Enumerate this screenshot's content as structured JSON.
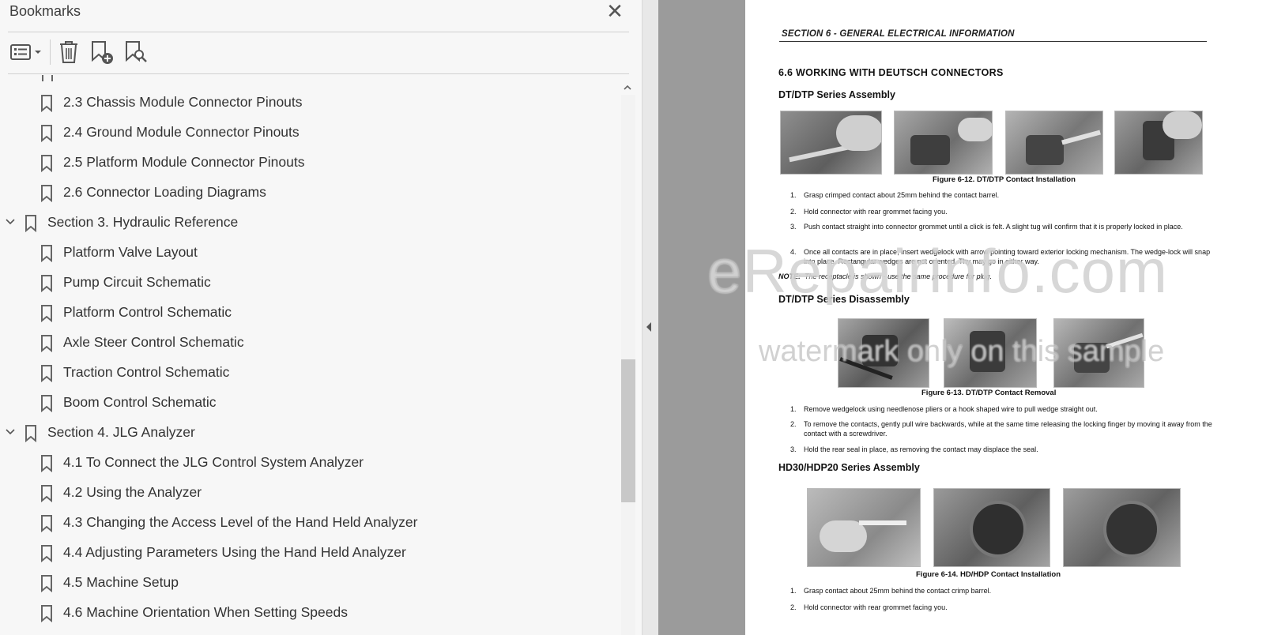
{
  "panel": {
    "title": "Bookmarks",
    "toolbar": {
      "options_icon": "list-options-icon",
      "delete_icon": "trash-icon",
      "new_bookmark_icon": "bookmark-add-icon",
      "find_bookmark_icon": "bookmark-search-icon"
    },
    "items": [
      {
        "level": 2,
        "label": "2.3 Chassis Module Connector Pinouts"
      },
      {
        "level": 2,
        "label": "2.4 Ground Module Connector Pinouts"
      },
      {
        "level": 2,
        "label": "2.5 Platform Module Connector Pinouts"
      },
      {
        "level": 2,
        "label": "2.6 Connector Loading Diagrams"
      },
      {
        "level": 1,
        "label": "Section 3. Hydraulic Reference",
        "expanded": true
      },
      {
        "level": 2,
        "label": "Platform Valve Layout"
      },
      {
        "level": 2,
        "label": "Pump Circuit Schematic"
      },
      {
        "level": 2,
        "label": "Platform Control Schematic"
      },
      {
        "level": 2,
        "label": "Axle Steer Control Schematic"
      },
      {
        "level": 2,
        "label": "Traction Control Schematic"
      },
      {
        "level": 2,
        "label": "Boom Control Schematic"
      },
      {
        "level": 1,
        "label": "Section 4. JLG Analyzer",
        "expanded": true
      },
      {
        "level": 2,
        "label": "4.1 To Connect the JLG Control System Analyzer"
      },
      {
        "level": 2,
        "label": "4.2 Using the Analyzer"
      },
      {
        "level": 2,
        "label": "4.3 Changing the Access Level of the Hand Held Analyzer"
      },
      {
        "level": 2,
        "label": "4.4 Adjusting Parameters Using the Hand Held Analyzer"
      },
      {
        "level": 2,
        "label": "4.5 Machine Setup"
      },
      {
        "level": 2,
        "label": "4.6 Machine Orientation When Setting Speeds"
      }
    ]
  },
  "document": {
    "section_header": "SECTION 6 - GENERAL ELECTRICAL INFORMATION",
    "heading": "6.6  WORKING WITH DEUTSCH CONNECTORS",
    "sub1": "DT/DTP Series Assembly",
    "fig1_caption": "Figure 6-12.  DT/DTP Contact Installation",
    "steps1": [
      {
        "num": "1.",
        "text": "Grasp crimped contact about 25mm behind the contact barrel."
      },
      {
        "num": "2.",
        "text": "Hold connector with rear grommet facing you."
      },
      {
        "num": "3.",
        "text": "Push contact straight into connector grommet until a click is felt. A slight tug will confirm that it is properly locked in place."
      },
      {
        "num": "4.",
        "text": "Once all contacts are in place, insert wedgelock with arrow pointing toward exterior locking mechanism. The wedge-lock will snap into place. Rectangular wedges are not oriented. Thy may go in either way."
      }
    ],
    "note_label": "NOTE:",
    "note_text": "The receptacle is shown - use the same procedure for plug.",
    "sub2": "DT/DTP Series Disassembly",
    "fig2_caption": "Figure 6-13.  DT/DTP Contact Removal",
    "steps2": [
      {
        "num": "1.",
        "text": "Remove wedgelock using needlenose pliers or a hook shaped wire to pull wedge straight out."
      },
      {
        "num": "2.",
        "text": "To remove the contacts, gently pull wire backwards, while at the same time releasing the locking finger by moving it away from the contact with a screwdriver."
      },
      {
        "num": "3.",
        "text": "Hold the rear seal in place, as removing the contact may displace the seal."
      }
    ],
    "sub3": "HD30/HDP20 Series Assembly",
    "fig3_caption": "Figure 6-14.  HD/HDP Contact Installation",
    "steps3": [
      {
        "num": "1.",
        "text": "Grasp contact about 25mm behind the contact crimp barrel."
      },
      {
        "num": "2.",
        "text": "Hold connector with rear grommet facing you."
      }
    ],
    "watermark_main": "eRepairinfo.com",
    "watermark_sub": "watermark only on this sample"
  }
}
